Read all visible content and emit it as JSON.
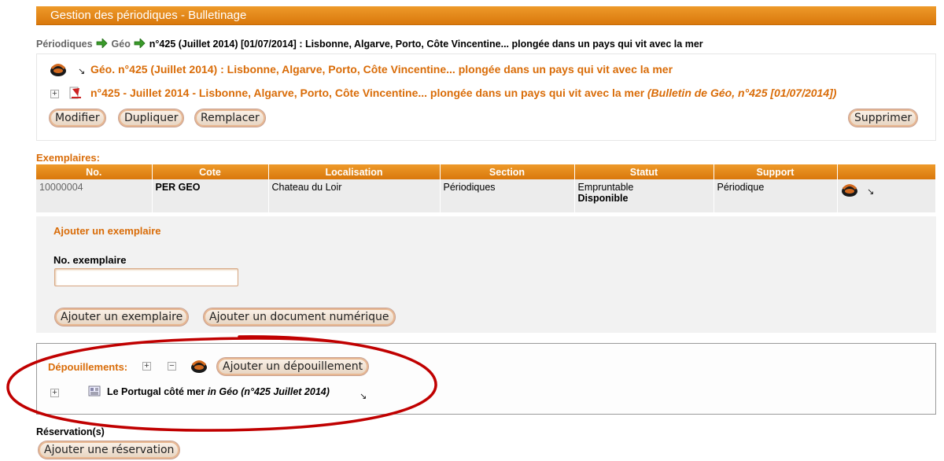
{
  "header": {
    "title": "Gestion des périodiques - Bulletinage"
  },
  "breadcrumb": {
    "item1": "Périodiques",
    "item2": "Géo",
    "current": "n°425 (Juillet 2014) [01/07/2014] : Lisbonne, Algarve, Porto, Côte Vincentine... plongée dans un pays qui vit avec la mer"
  },
  "notice": {
    "periodical_link": "Géo. n°425 (Juillet 2014) : Lisbonne, Algarve, Porto, Côte Vincentine... plongée dans un pays qui vit avec la mer",
    "bulletin_title": "n°425 - Juillet 2014 - Lisbonne, Algarve, Porto, Côte Vincentine... plongée dans un pays qui vit avec la mer",
    "bulletin_ref": "(Bulletin de Géo, n°425 [01/07/2014])",
    "buttons": {
      "modify": "Modifier",
      "duplicate": "Dupliquer",
      "replace": "Remplacer",
      "delete": "Supprimer"
    }
  },
  "exemplaires": {
    "label": "Exemplaires:",
    "columns": [
      "No.",
      "Cote",
      "Localisation",
      "Section",
      "Statut",
      "Support",
      ""
    ],
    "rows": [
      {
        "no": "10000004",
        "cote": "PER GEO",
        "localisation": "Chateau du Loir",
        "section": "Périodiques",
        "statut_line1": "Empruntable",
        "statut_line2": "Disponible",
        "support": "Périodique"
      }
    ]
  },
  "add_exemplaire": {
    "title": "Ajouter un exemplaire",
    "field_label": "No. exemplaire",
    "field_value": "",
    "btn_add": "Ajouter un exemplaire",
    "btn_add_digital": "Ajouter un document numérique"
  },
  "depouillements": {
    "label": "Dépouillements:",
    "btn_add": "Ajouter un dépouillement",
    "items": [
      {
        "title": "Le Portugal côté mer",
        "ref": "in Géo (n°425 Juillet 2014)"
      }
    ]
  },
  "reservation": {
    "label": "Réservation(s)",
    "btn_add": "Ajouter une réservation"
  },
  "colors": {
    "accent": "#d96c08",
    "header_bg": "#e88a1c",
    "annotation": "#c00000"
  }
}
